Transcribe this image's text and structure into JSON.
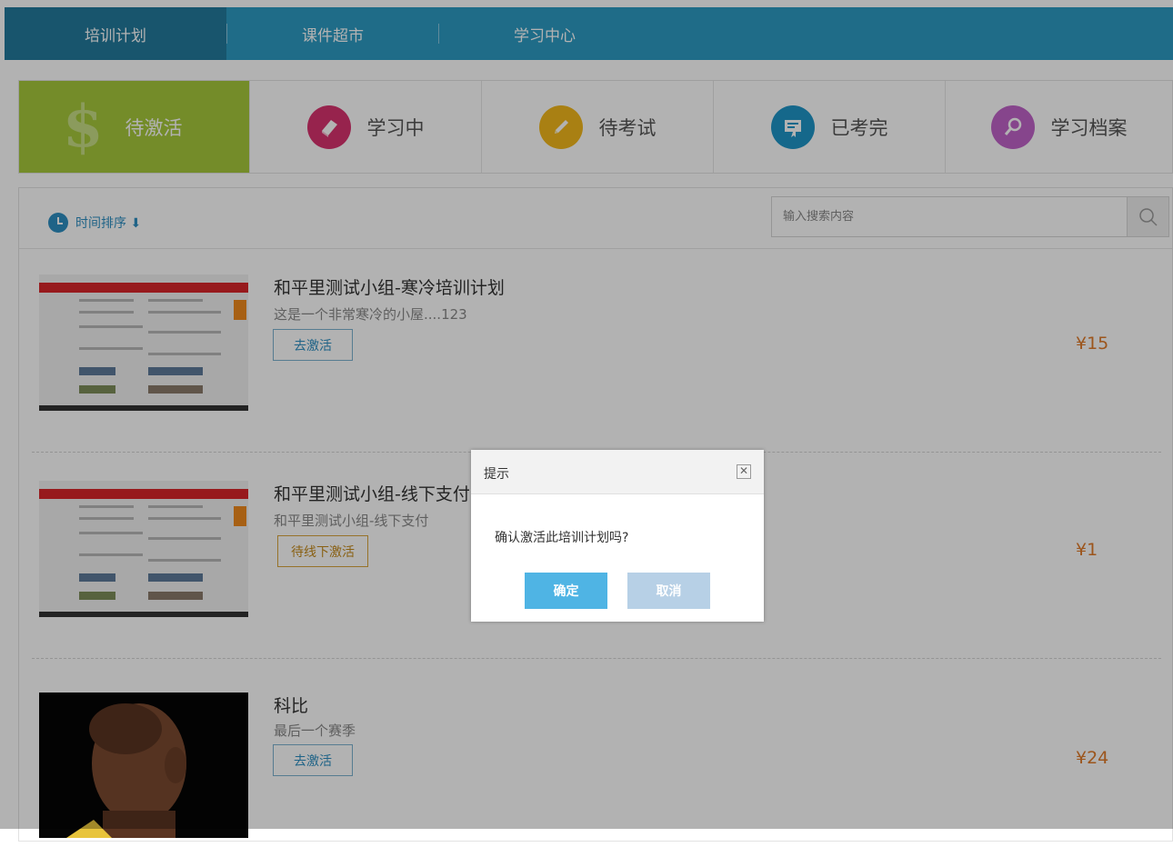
{
  "nav": {
    "tabs": [
      {
        "label": "培训计划",
        "active": true
      },
      {
        "label": "课件超市",
        "active": false
      },
      {
        "label": "学习中心",
        "active": false
      }
    ]
  },
  "categories": [
    {
      "label": "待激活",
      "icon": "dollar-icon",
      "active": true
    },
    {
      "label": "学习中",
      "icon": "book-icon",
      "color": "#d8336f"
    },
    {
      "label": "待考试",
      "icon": "pencil-icon",
      "color": "#f2b81c"
    },
    {
      "label": "已考完",
      "icon": "certificate-icon",
      "color": "#1f95c7"
    },
    {
      "label": "学习档案",
      "icon": "magnifier-icon",
      "color": "#c164c9"
    }
  ],
  "sort": {
    "label": "时间排序 ⬇"
  },
  "search": {
    "placeholder": "输入搜索内容"
  },
  "items": [
    {
      "title": "和平里测试小组-寒冷培训计划",
      "desc": "这是一个非常寒冷的小屋....123",
      "button": "去激活",
      "price": "¥15",
      "thumb": "website-screenshot"
    },
    {
      "title": "和平里测试小组-线下支付",
      "desc": "和平里测试小组-线下支付",
      "button": "待线下激活",
      "price": "¥1",
      "thumb": "website-screenshot"
    },
    {
      "title": "科比",
      "desc": "最后一个赛季",
      "button": "去激活",
      "price": "¥24",
      "thumb": "portrait-photo"
    }
  ],
  "dialog": {
    "title": "提示",
    "message": "确认激活此培训计划吗?",
    "ok": "确定",
    "cancel": "取消"
  },
  "colors": {
    "nav": "#2d9bc3",
    "active_category": "#a6c93b",
    "price": "#e07a29",
    "link": "#2d8fc2"
  }
}
